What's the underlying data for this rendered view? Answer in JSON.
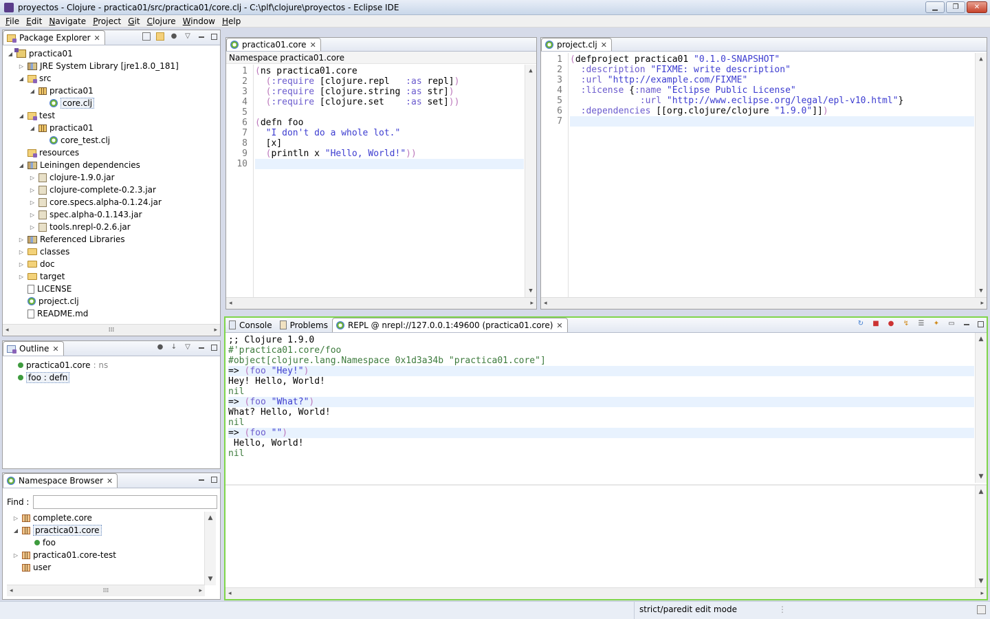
{
  "window": {
    "title": "proyectos - Clojure - practica01/src/practica01/core.clj - C:\\plf\\clojure\\proyectos - Eclipse IDE",
    "min": "▁",
    "max": "❐",
    "close": "✕"
  },
  "menu": [
    "File",
    "Edit",
    "Navigate",
    "Project",
    "Git",
    "Clojure",
    "Window",
    "Help"
  ],
  "package_explorer": {
    "tab": "Package Explorer",
    "items": [
      {
        "label": "practica01",
        "indent": 0,
        "twisty": "◢",
        "icon": "prj"
      },
      {
        "label": "JRE System Library [jre1.8.0_181]",
        "indent": 1,
        "twisty": "▷",
        "icon": "lib"
      },
      {
        "label": "src",
        "indent": 1,
        "twisty": "◢",
        "icon": "src"
      },
      {
        "label": "practica01",
        "indent": 2,
        "twisty": "◢",
        "icon": "pkg"
      },
      {
        "label": "core.clj",
        "indent": 3,
        "twisty": "",
        "icon": "clj",
        "selected": true
      },
      {
        "label": "test",
        "indent": 1,
        "twisty": "◢",
        "icon": "src"
      },
      {
        "label": "practica01",
        "indent": 2,
        "twisty": "◢",
        "icon": "pkg"
      },
      {
        "label": "core_test.clj",
        "indent": 3,
        "twisty": "",
        "icon": "clj"
      },
      {
        "label": "resources",
        "indent": 1,
        "twisty": "",
        "icon": "src"
      },
      {
        "label": "Leiningen dependencies",
        "indent": 1,
        "twisty": "◢",
        "icon": "lib"
      },
      {
        "label": "clojure-1.9.0.jar",
        "indent": 2,
        "twisty": "▷",
        "icon": "jar"
      },
      {
        "label": "clojure-complete-0.2.3.jar",
        "indent": 2,
        "twisty": "▷",
        "icon": "jar"
      },
      {
        "label": "core.specs.alpha-0.1.24.jar",
        "indent": 2,
        "twisty": "▷",
        "icon": "jar"
      },
      {
        "label": "spec.alpha-0.1.143.jar",
        "indent": 2,
        "twisty": "▷",
        "icon": "jar"
      },
      {
        "label": "tools.nrepl-0.2.6.jar",
        "indent": 2,
        "twisty": "▷",
        "icon": "jar"
      },
      {
        "label": "Referenced Libraries",
        "indent": 1,
        "twisty": "▷",
        "icon": "lib"
      },
      {
        "label": "classes",
        "indent": 1,
        "twisty": "▷",
        "icon": "folder"
      },
      {
        "label": "doc",
        "indent": 1,
        "twisty": "▷",
        "icon": "folder"
      },
      {
        "label": "target",
        "indent": 1,
        "twisty": "▷",
        "icon": "folder"
      },
      {
        "label": "LICENSE",
        "indent": 1,
        "twisty": "",
        "icon": "file"
      },
      {
        "label": "project.clj",
        "indent": 1,
        "twisty": "",
        "icon": "clj"
      },
      {
        "label": "README.md",
        "indent": 1,
        "twisty": "",
        "icon": "file"
      }
    ]
  },
  "outline": {
    "tab": "Outline",
    "items": [
      {
        "label": "practica01.core",
        "suffix": " : ns"
      },
      {
        "label": "foo : defn",
        "suffix": "",
        "selected": true
      }
    ]
  },
  "ns_browser": {
    "tab": "Namespace Browser",
    "find_label": "Find :",
    "find_value": "",
    "items": [
      {
        "label": "complete.core",
        "indent": 0,
        "twisty": "▷",
        "icon": "ns"
      },
      {
        "label": "practica01.core",
        "indent": 0,
        "twisty": "◢",
        "icon": "ns",
        "selected": true
      },
      {
        "label": "foo",
        "indent": 1,
        "twisty": "",
        "icon": "dot"
      },
      {
        "label": "practica01.core-test",
        "indent": 0,
        "twisty": "▷",
        "icon": "ns"
      },
      {
        "label": "user",
        "indent": 0,
        "twisty": "",
        "icon": "ns"
      }
    ]
  },
  "editor_core": {
    "tab": "practica01.core",
    "breadcrumb": "Namespace practica01.core",
    "lines": [
      [
        [
          "p",
          "("
        ],
        [
          "",
          "ns practica01.core"
        ]
      ],
      [
        [
          "",
          "  "
        ],
        [
          "p",
          "("
        ],
        [
          "kw",
          ":require"
        ],
        [
          "",
          " [clojure.repl   "
        ],
        [
          "kw",
          ":as"
        ],
        [
          "",
          " repl]"
        ],
        [
          "p",
          ")"
        ]
      ],
      [
        [
          "",
          "  "
        ],
        [
          "p",
          "("
        ],
        [
          "kw",
          ":require"
        ],
        [
          "",
          " [clojure.string "
        ],
        [
          "kw",
          ":as"
        ],
        [
          "",
          " str]"
        ],
        [
          "p",
          ")"
        ]
      ],
      [
        [
          "",
          "  "
        ],
        [
          "p",
          "("
        ],
        [
          "kw",
          ":require"
        ],
        [
          "",
          " [clojure.set    "
        ],
        [
          "kw",
          ":as"
        ],
        [
          "",
          " set]"
        ],
        [
          "p",
          "))"
        ]
      ],
      [],
      [
        [
          "p",
          "("
        ],
        [
          "",
          "defn foo"
        ]
      ],
      [
        [
          "",
          "  "
        ],
        [
          "s",
          "\"I don't do a whole lot.\""
        ]
      ],
      [
        [
          "",
          "  [x]"
        ]
      ],
      [
        [
          "",
          "  "
        ],
        [
          "p",
          "("
        ],
        [
          "",
          "println x "
        ],
        [
          "s",
          "\"Hello, World!\""
        ],
        [
          "p",
          "))"
        ]
      ],
      []
    ],
    "current_line": 10
  },
  "editor_project": {
    "tab": "project.clj",
    "lines": [
      [
        [
          "p",
          "("
        ],
        [
          "",
          "defproject practica01 "
        ],
        [
          "s",
          "\"0.1.0-SNAPSHOT\""
        ]
      ],
      [
        [
          "",
          "  "
        ],
        [
          "kw",
          ":description"
        ],
        [
          "",
          " "
        ],
        [
          "s",
          "\"FIXME: write description\""
        ]
      ],
      [
        [
          "",
          "  "
        ],
        [
          "kw",
          ":url"
        ],
        [
          "",
          " "
        ],
        [
          "s",
          "\"http://example.com/FIXME\""
        ]
      ],
      [
        [
          "",
          "  "
        ],
        [
          "kw",
          ":license"
        ],
        [
          "",
          " {"
        ],
        [
          "kw",
          ":name"
        ],
        [
          "",
          " "
        ],
        [
          "s",
          "\"Eclipse Public License\""
        ]
      ],
      [
        [
          "",
          "             "
        ],
        [
          "kw",
          ":url"
        ],
        [
          "",
          " "
        ],
        [
          "s",
          "\"http://www.eclipse.org/legal/epl-v10.html\""
        ],
        [
          "",
          "}"
        ]
      ],
      [
        [
          "",
          "  "
        ],
        [
          "kw",
          ":dependencies"
        ],
        [
          "",
          " [[org.clojure/clojure "
        ],
        [
          "s",
          "\"1.9.0\""
        ],
        [
          "",
          "]]"
        ],
        [
          "p",
          ")"
        ]
      ],
      []
    ],
    "current_line": 7
  },
  "bottom_tabs": [
    {
      "label": "Console"
    },
    {
      "label": "Problems"
    },
    {
      "label": "REPL @ nrepl://127.0.0.1:49600 (practica01.core)",
      "active": true
    }
  ],
  "repl": {
    "lines": [
      {
        "cls": "",
        "segs": [
          [
            "",
            ";; Clojure 1.9.0"
          ]
        ]
      },
      {
        "cls": "",
        "segs": [
          [
            "g",
            "#'practica01.core/foo"
          ]
        ]
      },
      {
        "cls": "",
        "segs": [
          [
            "g",
            "#object[clojure.lang.Namespace 0x1d3a34b \"practica01.core\"]"
          ]
        ]
      },
      {
        "cls": "cur",
        "segs": [
          [
            "",
            "=> "
          ],
          [
            "p",
            "("
          ],
          [
            "kw",
            "foo "
          ],
          [
            "s",
            "\"Hey!\""
          ],
          [
            "p",
            ")"
          ]
        ]
      },
      {
        "cls": "",
        "segs": [
          [
            "",
            "Hey! Hello, World!"
          ]
        ]
      },
      {
        "cls": "",
        "segs": [
          [
            "g",
            "nil"
          ]
        ]
      },
      {
        "cls": "cur",
        "segs": [
          [
            "",
            "=> "
          ],
          [
            "p",
            "("
          ],
          [
            "kw",
            "foo "
          ],
          [
            "s",
            "\"What?\""
          ],
          [
            "p",
            ")"
          ]
        ]
      },
      {
        "cls": "",
        "segs": [
          [
            "",
            "What? Hello, World!"
          ]
        ]
      },
      {
        "cls": "",
        "segs": [
          [
            "g",
            "nil"
          ]
        ]
      },
      {
        "cls": "cur",
        "segs": [
          [
            "",
            "=> "
          ],
          [
            "p",
            "("
          ],
          [
            "kw",
            "foo "
          ],
          [
            "s",
            "\"\""
          ],
          [
            "p",
            ")"
          ]
        ]
      },
      {
        "cls": "",
        "segs": [
          [
            "",
            " Hello, World!"
          ]
        ]
      },
      {
        "cls": "",
        "segs": [
          [
            "g",
            "nil"
          ]
        ]
      }
    ]
  },
  "status": {
    "mode": "strict/paredit edit mode"
  },
  "colors": {
    "repl_border": "#7fd54a",
    "keyword": "#6a5acd",
    "string": "#3c3cd0",
    "paren": "#bb77bb",
    "result": "#3c7a3c"
  },
  "scroll": {
    "h_grip": "⁞⁞⁞"
  }
}
